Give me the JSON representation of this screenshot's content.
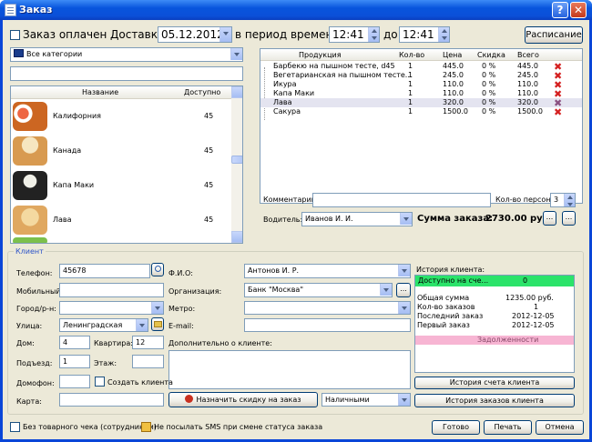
{
  "window": {
    "title": "Заказ"
  },
  "header": {
    "paid_label": "Заказ оплачен",
    "delivery_label": "Доставка",
    "delivery_date": "05.12.2012",
    "period_label": "в период времени с",
    "time_from": "12:41",
    "to_label": "до",
    "time_to": "12:41",
    "schedule_button": "Расписание"
  },
  "catalog": {
    "category": "Все категории",
    "search_value": "",
    "col_name": "Название",
    "col_available": "Доступно",
    "items": [
      {
        "name": "Калифорния",
        "available": "45"
      },
      {
        "name": "Канада",
        "available": "45"
      },
      {
        "name": "Капа Маки",
        "available": "45"
      },
      {
        "name": "Лава",
        "available": "45"
      }
    ]
  },
  "order": {
    "col_product": "Продукция",
    "col_qty": "Кол-во",
    "col_price": "Цена",
    "col_discount": "Скидка",
    "col_total": "Всего",
    "rows": [
      {
        "product": "Барбекю на пышном тесте, d45",
        "qty": "1",
        "price": "445.0",
        "discount": "0 %",
        "total": "445.0"
      },
      {
        "product": "Вегетарианская на пышном тесте...",
        "qty": "1",
        "price": "245.0",
        "discount": "0 %",
        "total": "245.0"
      },
      {
        "product": "Икура",
        "qty": "1",
        "price": "110.0",
        "discount": "0 %",
        "total": "110.0"
      },
      {
        "product": "Капа Маки",
        "qty": "1",
        "price": "110.0",
        "discount": "0 %",
        "total": "110.0"
      },
      {
        "product": "Лава",
        "qty": "1",
        "price": "320.0",
        "discount": "0 %",
        "total": "320.0"
      },
      {
        "product": "Сакура",
        "qty": "1",
        "price": "1500.0",
        "discount": "0 %",
        "total": "1500.0"
      }
    ]
  },
  "comment": {
    "label": "Комментарий:",
    "value": "",
    "persons_label": "Кол-во персон:",
    "persons": "3"
  },
  "driver": {
    "label": "Водитель:",
    "value": "Иванов И. И.",
    "sum_label": "Сумма заказа:",
    "sum_value": "2730.00 руб.",
    "btn1": "...",
    "btn2": "..."
  },
  "client": {
    "group_label": "Клиент",
    "phone_label": "Телефон:",
    "phone": "45678",
    "fio_label": "Ф.И.О:",
    "fio": "Антонов И. Р.",
    "mobile_label": "Мобильный:",
    "mobile": "",
    "org_label": "Организация:",
    "org": "Банк \"Москва\"",
    "org_btn": "...",
    "city_label": "Город/р-н:",
    "city": "",
    "metro_label": "Метро:",
    "metro": "",
    "street_label": "Улица:",
    "street": "Ленинградская",
    "email_label": "E-mail:",
    "email": "",
    "house_label": "Дом:",
    "house": "4",
    "flat_label": "Квартира:",
    "flat": "12",
    "extra_label": "Дополнительно о клиенте:",
    "extra": "",
    "entrance_label": "Подъезд:",
    "entrance": "1",
    "floor_label": "Этаж:",
    "floor": "",
    "intercom_label": "Домофон:",
    "intercom": "",
    "create_label": "Создать клиента",
    "card_label": "Карта:",
    "card": "",
    "discount_button": "Назначить скидку на заказ",
    "payment": "Наличными"
  },
  "history": {
    "label": "История клиента:",
    "bar_label": "Доступно на сче...",
    "bar_value": "0",
    "stats": [
      {
        "k": "Общая сумма",
        "v": "1235.00 руб."
      },
      {
        "k": "Кол-во заказов",
        "v": "1"
      },
      {
        "k": "Последний заказ",
        "v": "2012-12-05"
      },
      {
        "k": "Первый заказ",
        "v": "2012-12-05"
      }
    ],
    "debts": "Задолженности",
    "account_button": "История счета клиента",
    "orders_button": "История заказов клиента"
  },
  "footer": {
    "no_receipt": "Без товарного чека (сотрудникам)",
    "no_sms": "Не посылать SMS при смене статуса заказа",
    "ready": "Готово",
    "print": "Печать",
    "cancel": "Отмена"
  },
  "colors": {
    "titlebar": "#0855dd",
    "window_bg": "#ece9d8",
    "available_bar": "#2be36a",
    "debts_bar": "#f7b5d3",
    "delete_icon": "#d42020",
    "selected_row": "#e4e4f0"
  }
}
